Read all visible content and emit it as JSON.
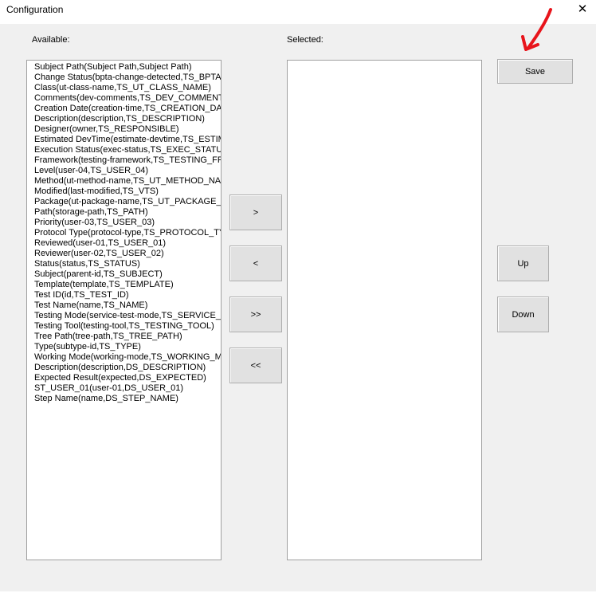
{
  "window": {
    "title": "Configuration",
    "close_glyph": "✕"
  },
  "labels": {
    "available": "Available:",
    "selected": "Selected:"
  },
  "available_items": [
    "Subject Path(Subject Path,Subject Path)",
    "Change Status(bpta-change-detected,TS_BPTA_",
    "Class(ut-class-name,TS_UT_CLASS_NAME)",
    "Comments(dev-comments,TS_DEV_COMMENTS)",
    "Creation Date(creation-time,TS_CREATION_DAT",
    "Description(description,TS_DESCRIPTION)",
    "Designer(owner,TS_RESPONSIBLE)",
    "Estimated DevTime(estimate-devtime,TS_ESTIMA",
    "Execution Status(exec-status,TS_EXEC_STATUS",
    "Framework(testing-framework,TS_TESTING_FRA",
    "Level(user-04,TS_USER_04)",
    "Method(ut-method-name,TS_UT_METHOD_NAME",
    "Modified(last-modified,TS_VTS)",
    "Package(ut-package-name,TS_UT_PACKAGE_NA",
    "Path(storage-path,TS_PATH)",
    "Priority(user-03,TS_USER_03)",
    "Protocol Type(protocol-type,TS_PROTOCOL_TYF",
    "Reviewed(user-01,TS_USER_01)",
    "Reviewer(user-02,TS_USER_02)",
    "Status(status,TS_STATUS)",
    "Subject(parent-id,TS_SUBJECT)",
    "Template(template,TS_TEMPLATE)",
    "Test ID(id,TS_TEST_ID)",
    "Test Name(name,TS_NAME)",
    "Testing Mode(service-test-mode,TS_SERVICE_TI",
    "Testing Tool(testing-tool,TS_TESTING_TOOL)",
    "Tree Path(tree-path,TS_TREE_PATH)",
    "Type(subtype-id,TS_TYPE)",
    "Working Mode(working-mode,TS_WORKING_MO",
    "Description(description,DS_DESCRIPTION)",
    "Expected Result(expected,DS_EXPECTED)",
    "ST_USER_01(user-01,DS_USER_01)",
    "Step Name(name,DS_STEP_NAME)"
  ],
  "selected_items": [],
  "buttons": {
    "save": "Save",
    "add": ">",
    "remove": "<",
    "add_all": ">>",
    "remove_all": "<<",
    "up": "Up",
    "down": "Down"
  },
  "annotation": {
    "icon": "red-arrow-icon",
    "color": "#e8141b"
  }
}
